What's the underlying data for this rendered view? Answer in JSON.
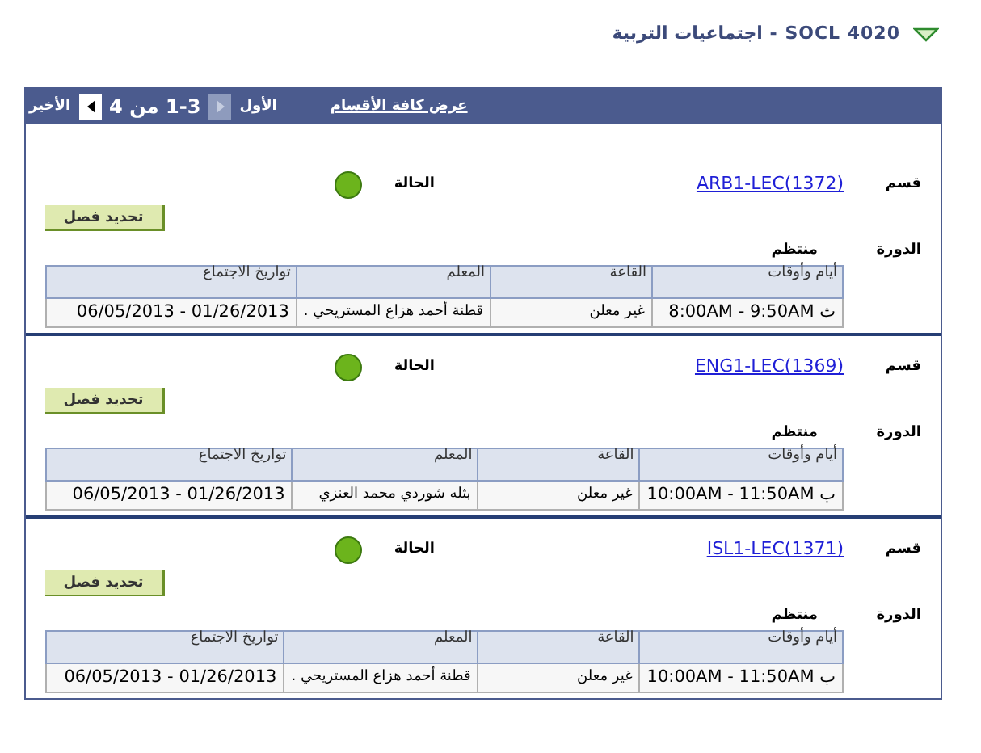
{
  "course": {
    "expanded": true,
    "title": "SOCL  4020 - اجتماعيات التربية"
  },
  "toolbar": {
    "view_all": "عرض كافة الأقسام",
    "first": "الأول",
    "prev_disabled": true,
    "range": "1-3 من 4",
    "next_disabled": false,
    "last": "الأخير"
  },
  "sections": [
    {
      "section_label": "قسم",
      "section": "ARB1-LEC(1372)",
      "status_label": "الحالة",
      "open": true,
      "button": "تحديد فصل",
      "session_label": "الدورة",
      "session": "منتظم",
      "columns": [
        "أيام وأوقات",
        "القاعة",
        "المعلم",
        "تواريخ الاجتماع"
      ],
      "rows": [
        [
          "ث 8:00AM - 9:50AM",
          "غير معلن",
          "قطنة أحمد هزاع المستريحي .",
          "01/26/2013 - 06/05/2013"
        ]
      ]
    },
    {
      "section_label": "قسم",
      "section": "ENG1-LEC(1369)",
      "status_label": "الحالة",
      "open": true,
      "button": "تحديد فصل",
      "session_label": "الدورة",
      "session": "منتظم",
      "columns": [
        "أيام وأوقات",
        "القاعة",
        "المعلم",
        "تواريخ الاجتماع"
      ],
      "rows": [
        [
          "ب 10:00AM - 11:50AM",
          "غير معلن",
          "بثله شوردي محمد العنزي",
          "01/26/2013 - 06/05/2013"
        ]
      ]
    },
    {
      "section_label": "قسم",
      "section": "ISL1-LEC(1371)",
      "status_label": "الحالة",
      "open": true,
      "button": "تحديد فصل",
      "session_label": "الدورة",
      "session": "منتظم",
      "columns": [
        "أيام وأوقات",
        "القاعة",
        "المعلم",
        "تواريخ الاجتماع"
      ],
      "rows": [
        [
          "ب 10:00AM - 11:50AM",
          "غير معلن",
          "قطنة أحمد هزاع المستريحي .",
          "01/26/2013 - 06/05/2013"
        ]
      ]
    }
  ]
}
